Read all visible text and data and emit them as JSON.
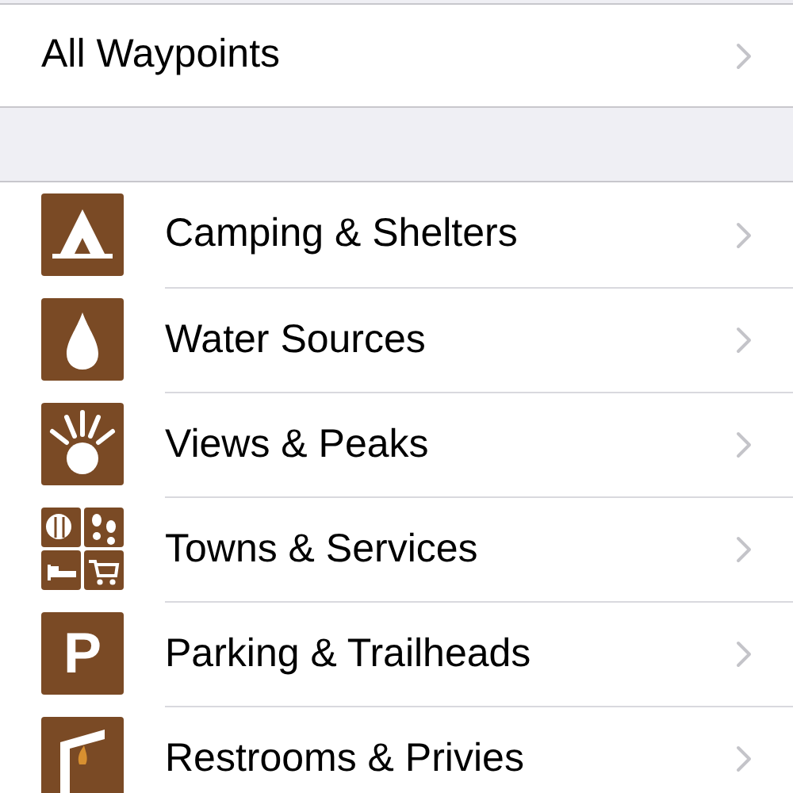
{
  "top_item": {
    "label": "All Waypoints"
  },
  "categories": [
    {
      "label": "Camping & Shelters",
      "kind": "tent"
    },
    {
      "label": "Water Sources",
      "kind": "drop"
    },
    {
      "label": "Views & Peaks",
      "kind": "sun"
    },
    {
      "label": "Towns & Services",
      "kind": "services"
    },
    {
      "label": "Parking & Trailheads",
      "kind": "letter",
      "icon_text": "P"
    },
    {
      "label": "Restrooms & Privies",
      "kind": "privy"
    }
  ]
}
